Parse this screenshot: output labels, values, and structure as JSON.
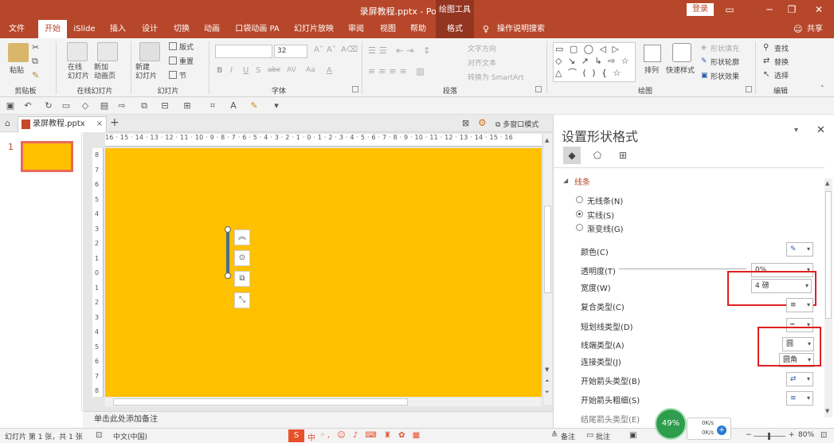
{
  "window": {
    "title": "录屏教程.pptx  -  PowerPoint",
    "context_tool": "绘图工具",
    "login": "登录",
    "controls": [
      "▭",
      "─",
      "❐",
      "✕"
    ]
  },
  "tabs": [
    "文件",
    "开始",
    "iSlide",
    "插入",
    "设计",
    "切换",
    "动画",
    "口袋动画 PA",
    "幻灯片放映",
    "审阅",
    "视图",
    "帮助",
    "格式"
  ],
  "tell_me": "操作说明搜索",
  "share": "共享",
  "ribbon": {
    "clipboard": {
      "label": "剪贴板",
      "paste": "粘贴"
    },
    "online": {
      "label": "在线幻灯片",
      "btn1": "在线\n幻灯片",
      "btn2": "新加\n动画页"
    },
    "slides": {
      "label": "幻灯片",
      "new": "新建\n幻灯片",
      "layout": "版式",
      "reset": "重置",
      "section": "节"
    },
    "font": {
      "label": "字体",
      "size": "32",
      "btns": [
        "B",
        "I",
        "U",
        "S",
        "abc",
        "AV",
        "Aa",
        "A"
      ]
    },
    "paragraph": {
      "label": "段落",
      "text_direction": "文字方向",
      "align_text": "对齐文本",
      "smartart": "转换为 SmartArt"
    },
    "drawing": {
      "label": "绘图",
      "arrange": "排列",
      "quick_styles": "快速样式",
      "fill": "形状填充",
      "outline": "形状轮廓",
      "effects": "形状效果"
    },
    "editing": {
      "label": "编辑",
      "find": "查找",
      "replace": "替换",
      "select": "选择"
    }
  },
  "doc_tab": {
    "name": "录屏教程.pptx",
    "multiwin": "多窗口模式"
  },
  "thumb_number": "1",
  "ruler_h": "16 · 15 · 14 · 13 · 12 · 11 · 10 · 9 · 8 · 7 · 6 · 5 · 4 · 3 · 2 · 1 · 0 · 1 · 2 · 3 · 4 · 5 · 6 · 7 · 8 · 9 · 10 · 11 · 12 · 13 · 14 · 15 · 16",
  "ruler_v": [
    "8",
    "7",
    "6",
    "5",
    "4",
    "3",
    "2",
    "1",
    "0",
    "1",
    "2",
    "3",
    "4",
    "5",
    "6",
    "7",
    "8"
  ],
  "notes": "单击此处添加备注",
  "format_pane": {
    "title": "设置形状格式",
    "section": "线条",
    "line_options": [
      "无线条(N)",
      "实线(S)",
      "渐变线(G)"
    ],
    "selected_option": 1,
    "color_label": "颜色(C)",
    "transparency_label": "透明度(T)",
    "transparency_value": "0%",
    "width_label": "宽度(W)",
    "width_value": "4 磅",
    "compound_label": "复合类型(C)",
    "dash_label": "短划线类型(D)",
    "cap_label": "线端类型(A)",
    "cap_value": "圆",
    "join_label": "连接类型(J)",
    "join_value": "圆角",
    "begin_arrow_type": "开始箭头类型(B)",
    "begin_arrow_size": "开始箭头粗细(S)",
    "end_arrow_type": "结尾箭头类型(E)"
  },
  "statusbar": {
    "slide_info": "幻灯片 第 1 张，共 1 张",
    "lang": "中文(中国)",
    "notes_btn": "备注",
    "comments_btn": "批注",
    "zoom": "80%",
    "perf": "49%",
    "net_up": "0K/s",
    "net_down": "0K/s",
    "ime": "中"
  },
  "colors": {
    "brand": "#b7472a",
    "slide_bg": "#ffc000",
    "shape_line": "#4a6e8a",
    "highlight": "#e02020"
  }
}
